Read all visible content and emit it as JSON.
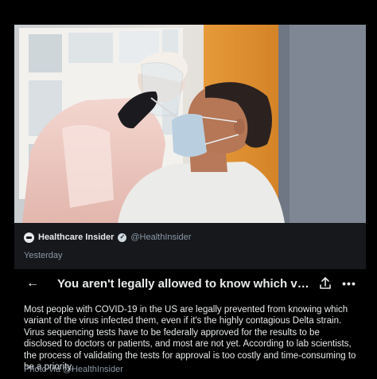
{
  "source": {
    "name": "Healthcare Insider",
    "handle": "@HealthInsider",
    "verified_icon": "verified-badge-icon",
    "logo_icon": "publisher-logo-icon"
  },
  "date_label": "Yesterday",
  "sheet": {
    "back_icon": "arrow-left-icon",
    "back_glyph": "←",
    "title": "You aren't legally allowed to know which va...",
    "share_icon": "share-icon",
    "more_icon": "more-horizontal-icon",
    "more_glyph": "•••",
    "body": "Most people with COVID-19 in the US are legally prevented from knowing which variant of the virus infected them, even if it's the highly contagious Delta strain. Virus sequencing tests have to be federally approved for the results to be disclosed to doctors or patients, and most are not yet. According to lab scientists, the process of validating the tests for approval is too costly and time-consuming to be a priority.",
    "credit": "Photo via @HealthInsider"
  },
  "colors": {
    "background": "#000000",
    "card": "#16181c",
    "text": "#e7e9ea",
    "muted": "#8b98a5"
  }
}
